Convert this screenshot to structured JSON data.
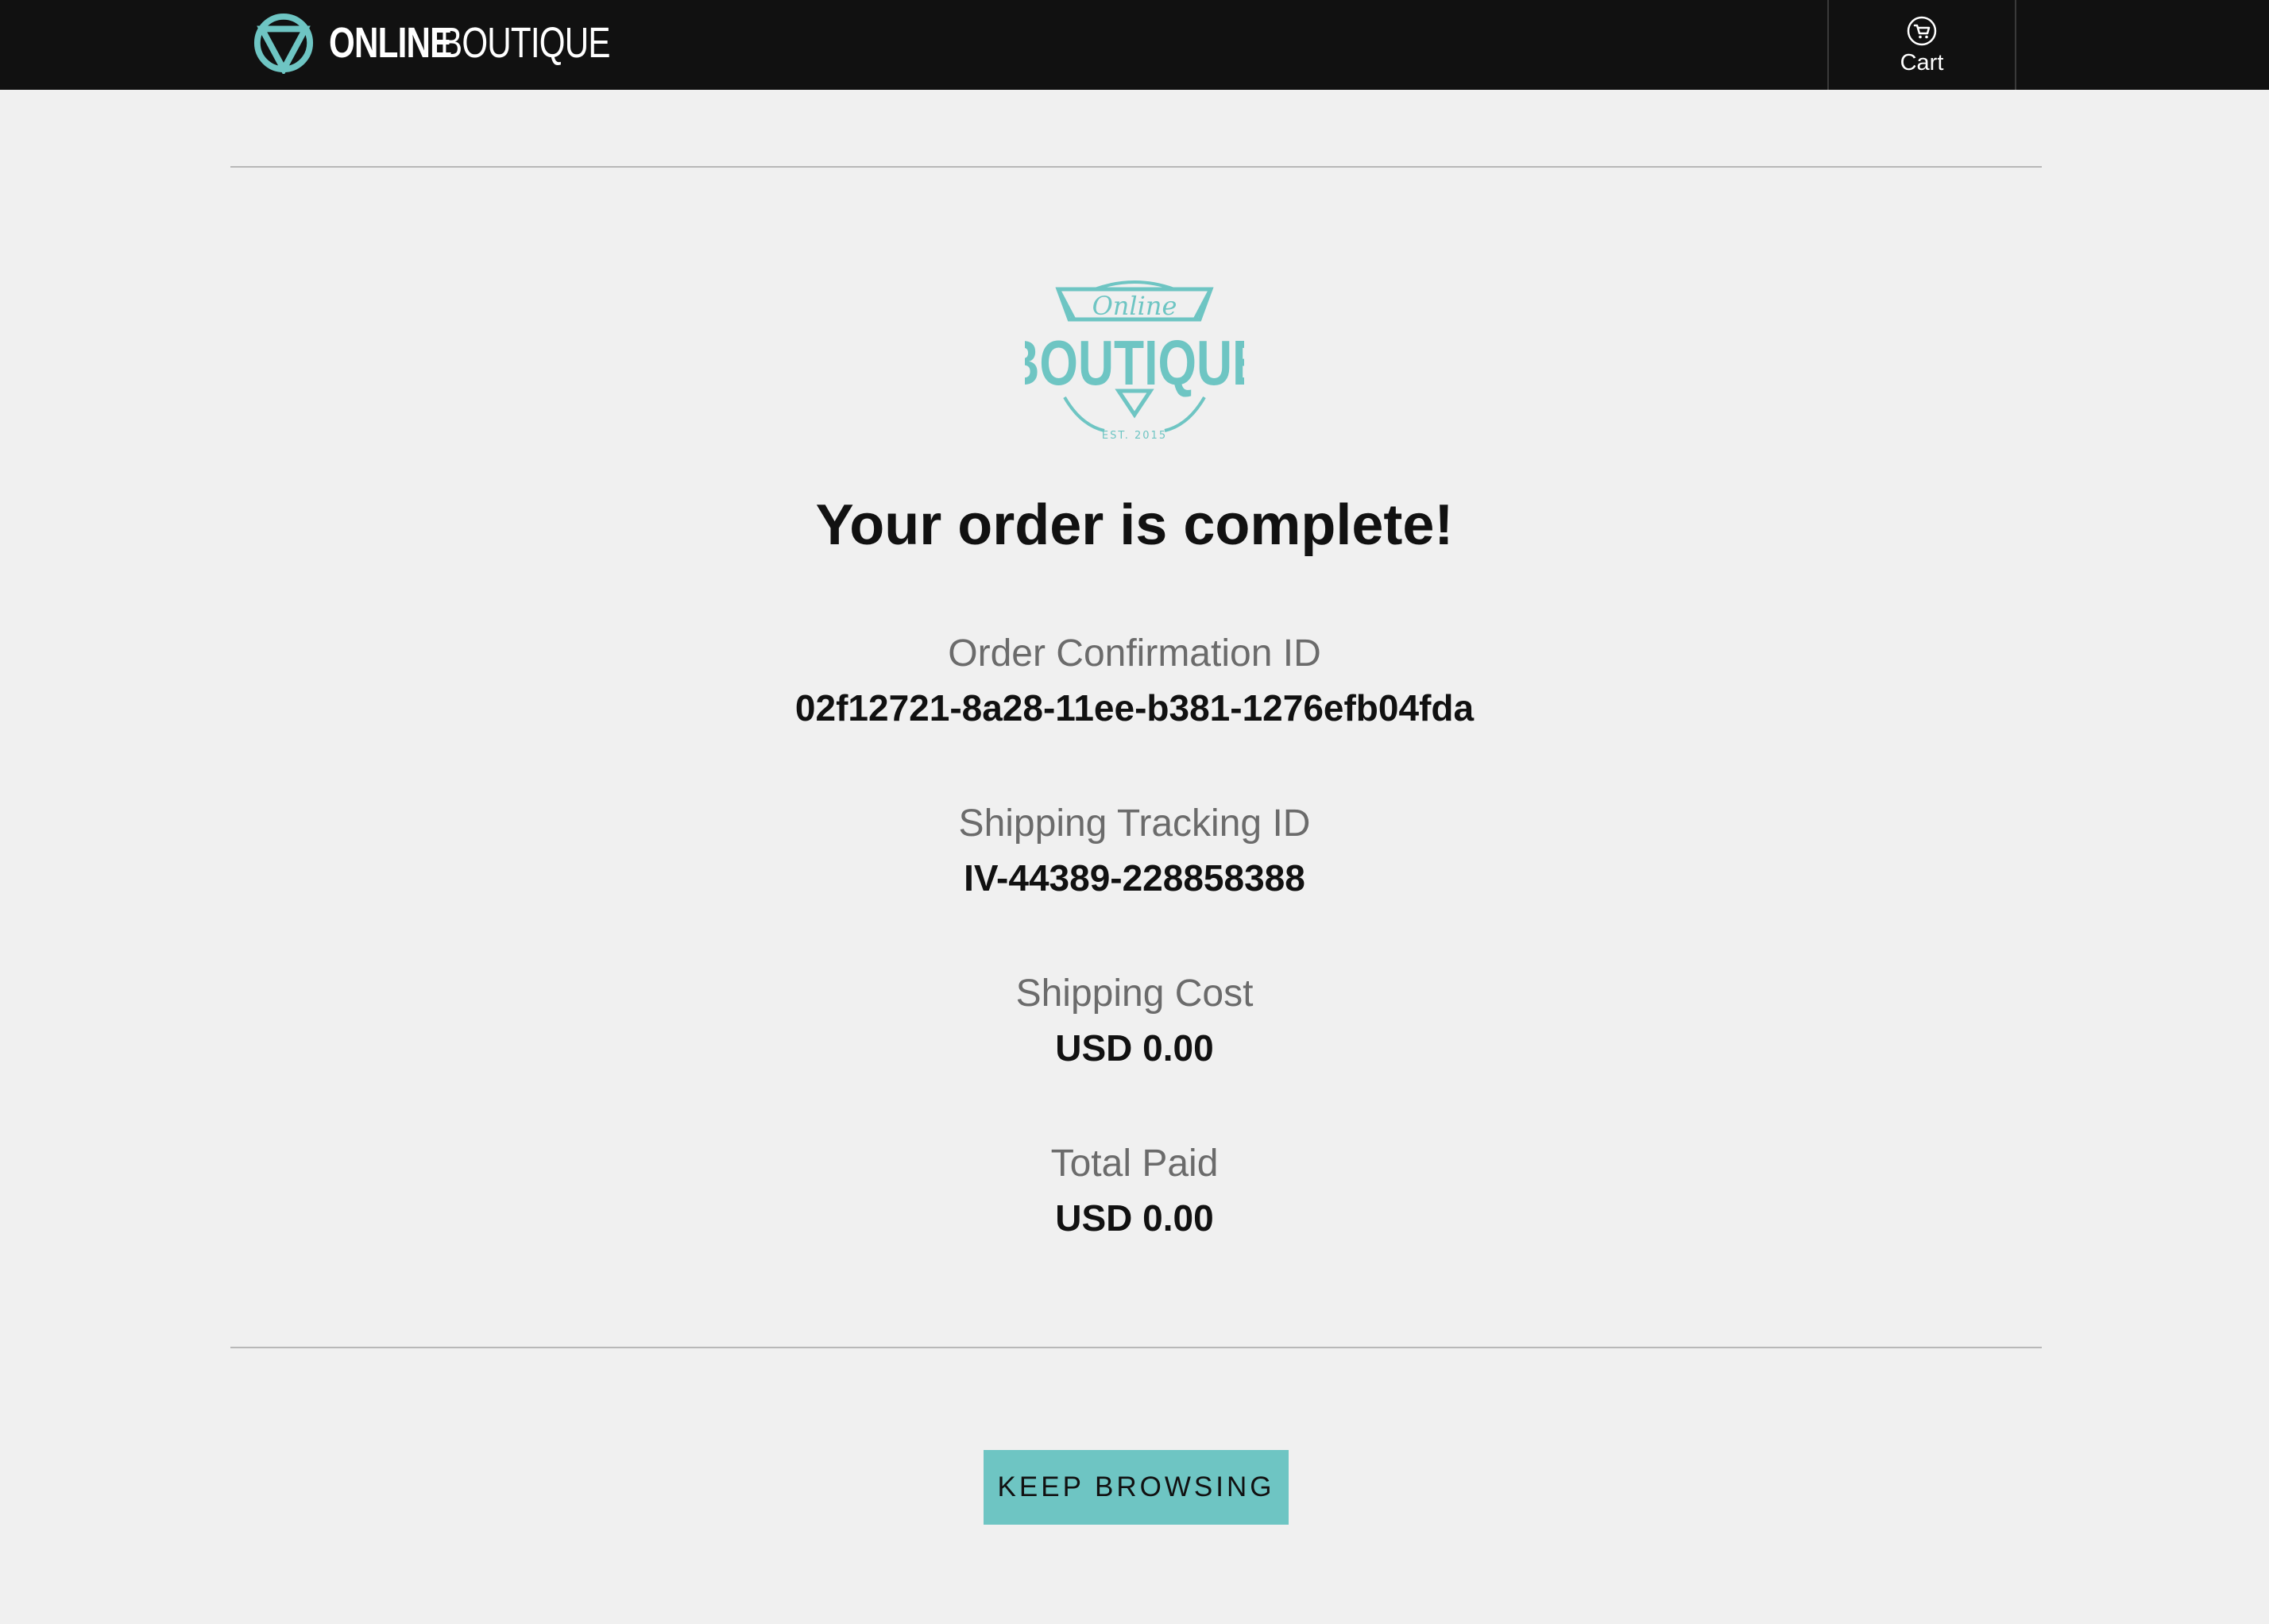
{
  "header": {
    "brand_bold": "ONLINE",
    "brand_light": "BOUTIQUE",
    "cart_label": "Cart",
    "accent_color": "#6ec5c3",
    "background_color": "#111111",
    "cart_icon": "cart-icon",
    "brand_icon": "triangle-in-circle-icon"
  },
  "logo": {
    "script_text": "Online",
    "main_text": "BOUTIQUE",
    "est_text": "EST. 2015"
  },
  "order": {
    "title": "Your order is complete!",
    "fields": [
      {
        "label": "Order Confirmation ID",
        "value": "02f12721-8a28-11ee-b381-1276efb04fda"
      },
      {
        "label": "Shipping Tracking ID",
        "value": "IV-44389-228858388"
      },
      {
        "label": "Shipping Cost",
        "value": "USD 0.00"
      },
      {
        "label": "Total Paid",
        "value": "USD 0.00"
      }
    ]
  },
  "actions": {
    "keep_browsing": "KEEP BROWSING"
  }
}
